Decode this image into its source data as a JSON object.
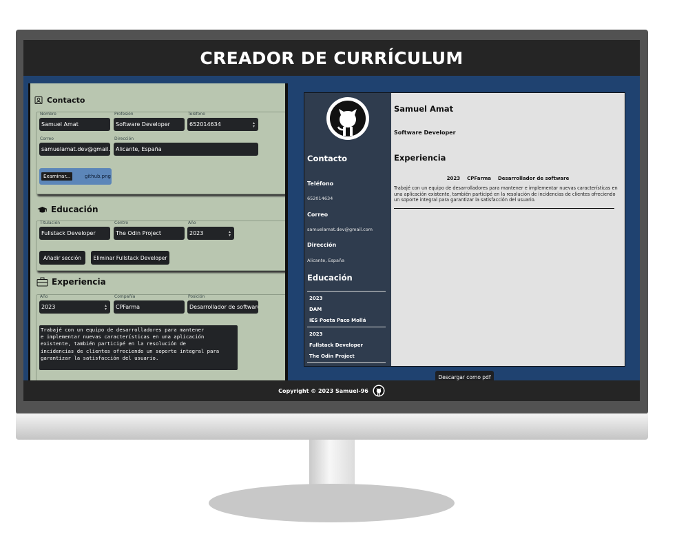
{
  "app": {
    "title": "CREADOR DE CURRÍCULUM",
    "footer": "Copyright © 2023 Samuel-96"
  },
  "form": {
    "contact": {
      "title": "Contacto",
      "name_label": "Nombre",
      "name_value": "Samuel Amat",
      "profession_label": "Profesión",
      "profession_value": "Software Developer",
      "phone_label": "Teléfono",
      "phone_value": "652014634",
      "email_label": "Correo",
      "email_value": "samuelamat.dev@gmail.com",
      "address_label": "Dirección",
      "address_value": "Alicante, España",
      "file_button": "Examinar...",
      "file_name": "github.png"
    },
    "education": {
      "title": "Educación",
      "degree_label": "Titulación",
      "degree_value": "Fullstack Developer",
      "center_label": "Centro",
      "center_value": "The Odin Project",
      "year_label": "Año",
      "year_value": "2023",
      "add_button": "Añadir sección",
      "remove_button": "Eliminar Fullstack Developer"
    },
    "experience": {
      "title": "Experiencia",
      "year_label": "Año",
      "year_value": "2023",
      "company_label": "Compañía",
      "company_value": "CPFarma",
      "position_label": "Posición",
      "position_value": "Desarrollador de software",
      "description": "Trabajé con un equipo de desarrolladores para mantener\ne implementar nuevas características en una aplicación\nexistente, también participé en la resolución de\nincidencias de clientes ofreciendo un soporte integral para\ngarantizar la satisfacción del usuario."
    }
  },
  "cv": {
    "name": "Samuel Amat",
    "job": "Software Developer",
    "sidebar": {
      "contact_heading": "Contacto",
      "phone_label": "Teléfono",
      "phone": "652014634",
      "email_label": "Correo",
      "email": "samuelamat.dev@gmail.com",
      "address_label": "Dirección",
      "address": "Alicante, España",
      "education_heading": "Educación",
      "education": [
        {
          "year": "2023",
          "degree": "DAM",
          "center": "IES Poeta Paco Mollá"
        },
        {
          "year": "2023",
          "degree": "Fullstack Developer",
          "center": "The Odin Project"
        }
      ]
    },
    "experience_heading": "Experiencia",
    "experience": {
      "year": "2023",
      "company": "CPFarma",
      "position": "Desarrollador de software",
      "description": "Trabajé con un equipo de desarrolladores para mantener e implementar nuevas características en una aplicación existente, también participé en la resolución de incidencias de clientes ofreciendo un soporte integral para garantizar la satisfacción del usuario."
    }
  },
  "download_button": "Descargar como pdf",
  "colors": {
    "screen_bg": "#1f4270",
    "form_bg": "#b9c6b0",
    "header_bg": "#252525",
    "cv_sidebar": "#2f3c4e",
    "file_box": "#5c86b9"
  },
  "icons": [
    "contact-card-icon",
    "graduation-cap-icon",
    "briefcase-icon",
    "github-icon"
  ]
}
